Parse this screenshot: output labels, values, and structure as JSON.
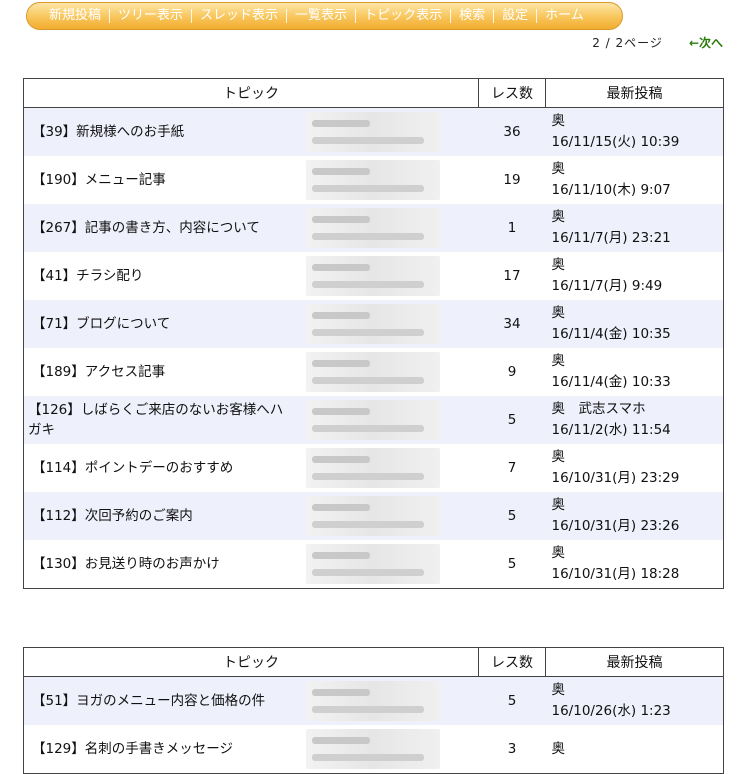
{
  "nav": {
    "items": [
      "新規投稿",
      "ツリー表示",
      "スレッド表示",
      "一覧表示",
      "トピック表示",
      "検索",
      "設定",
      "ホーム"
    ]
  },
  "pager": {
    "count": "2 / 2ページ",
    "next": "←次へ"
  },
  "table1": {
    "headers": [
      "トピック",
      "レス数",
      "最新投稿"
    ],
    "rows": [
      {
        "topic": "【39】新規様へのお手紙",
        "count": "36",
        "author": "奥",
        "date": "16/11/15(火) 10:39"
      },
      {
        "topic": "【190】メニュー記事",
        "count": "19",
        "author": "奥",
        "date": "16/11/10(木) 9:07"
      },
      {
        "topic": "【267】記事の書き方、内容について",
        "count": "1",
        "author": "奥",
        "date": "16/11/7(月) 23:21"
      },
      {
        "topic": "【41】チラシ配り",
        "count": "17",
        "author": "奥",
        "date": "16/11/7(月) 9:49"
      },
      {
        "topic": "【71】ブログについて",
        "count": "34",
        "author": "奥",
        "date": "16/11/4(金) 10:35"
      },
      {
        "topic": "【189】アクセス記事",
        "count": "9",
        "author": "奥",
        "date": "16/11/4(金) 10:33"
      },
      {
        "topic": "【126】しばらくご来店のないお客様へハガキ",
        "count": "5",
        "author": "奥　武志スマホ",
        "date": "16/11/2(水) 11:54"
      },
      {
        "topic": "【114】ポイントデーのおすすめ",
        "count": "7",
        "author": "奥",
        "date": "16/10/31(月) 23:29"
      },
      {
        "topic": "【112】次回予約のご案内",
        "count": "5",
        "author": "奥",
        "date": "16/10/31(月) 23:26"
      },
      {
        "topic": "【130】お見送り時のお声かけ",
        "count": "5",
        "author": "奥",
        "date": "16/10/31(月) 18:28"
      }
    ]
  },
  "table2": {
    "headers": [
      "トピック",
      "レス数",
      "最新投稿"
    ],
    "rows": [
      {
        "topic": "【51】ヨガのメニュー内容と価格の件",
        "count": "5",
        "author": "奥",
        "date": "16/10/26(水) 1:23"
      },
      {
        "topic": "【129】名刺の手書きメッセージ",
        "count": "3",
        "author": "奥",
        "date": ""
      }
    ]
  }
}
